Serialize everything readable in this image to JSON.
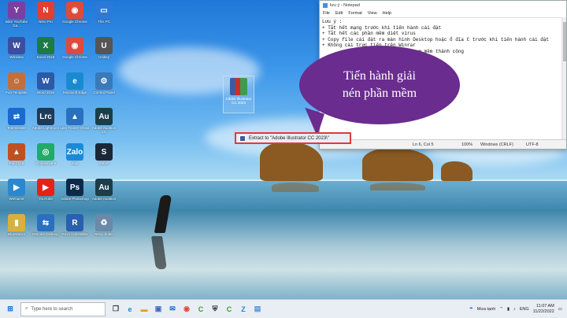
{
  "desktop_icons": [
    {
      "label": "Bâm YouTube Ga...",
      "color": "#7b3fa0",
      "glyph": "Y",
      "icon": "app-icon"
    },
    {
      "label": "Nitro Pro",
      "color": "#e04030",
      "glyph": "N",
      "icon": "nitro-icon"
    },
    {
      "label": "Google Chrome",
      "color": "#dd4b3a",
      "glyph": "◉",
      "icon": "chrome-icon"
    },
    {
      "label": "This PC",
      "color": "#2c7ad6",
      "glyph": "▭",
      "icon": "pc-icon"
    },
    {
      "label": "Wikiview",
      "color": "#3a4fa0",
      "glyph": "W",
      "icon": "app-icon"
    },
    {
      "label": "Excel 2016",
      "color": "#1d7a45",
      "glyph": "X",
      "icon": "excel-icon"
    },
    {
      "label": "Google Chrome",
      "color": "#dd4b3a",
      "glyph": "◉",
      "icon": "chrome-icon"
    },
    {
      "label": "Unikey",
      "color": "#555",
      "glyph": "U",
      "icon": "app-icon"
    },
    {
      "label": "Fun-Template",
      "color": "#c07040",
      "glyph": "☺",
      "icon": "app-icon"
    },
    {
      "label": "Word 2016",
      "color": "#2a5aa8",
      "glyph": "W",
      "icon": "word-icon"
    },
    {
      "label": "Microsoft Edge",
      "color": "#1a8ad0",
      "glyph": "e",
      "icon": "edge-icon"
    },
    {
      "label": "Control Panel",
      "color": "#3a7ab8",
      "glyph": "⚙",
      "icon": "control-panel-icon"
    },
    {
      "label": "Teamviewer",
      "color": "#1a6ad0",
      "glyph": "⇄",
      "icon": "teamviewer-icon"
    },
    {
      "label": "Adobe Lightroom",
      "color": "#1d3a5a",
      "glyph": "Lrc",
      "icon": "lightroom-icon"
    },
    {
      "label": "Line Trainer Ghost",
      "color": "#2a70c0",
      "glyph": "▲",
      "icon": "app-icon"
    },
    {
      "label": "Adobe Audition CC",
      "color": "#1b3e4a",
      "glyph": "Au",
      "icon": "audition-icon"
    },
    {
      "label": "Far Cry 5",
      "color": "#c05020",
      "glyph": "▲",
      "icon": "game-icon"
    },
    {
      "label": "CloneDrive 5",
      "color": "#22aa66",
      "glyph": "◎",
      "icon": "app-icon"
    },
    {
      "label": "Zalo",
      "color": "#1a8ad8",
      "glyph": "Zalo",
      "icon": "zalo-icon"
    },
    {
      "label": "Steam",
      "color": "#1b2838",
      "glyph": "S",
      "icon": "steam-icon"
    },
    {
      "label": "WeGame",
      "color": "#2a88d0",
      "glyph": "▶",
      "icon": "app-icon"
    },
    {
      "label": "YouTube",
      "color": "#e62117",
      "glyph": "▶",
      "icon": "youtube-icon"
    },
    {
      "label": "Adobe Photoshop",
      "color": "#0b2a4a",
      "glyph": "Ps",
      "icon": "photoshop-icon"
    },
    {
      "label": "Adobe Audition",
      "color": "#1b3e4a",
      "glyph": "Au",
      "icon": "audition-icon"
    },
    {
      "label": "Bluestacks",
      "color": "#d8b040",
      "glyph": "▮",
      "icon": "app-icon"
    },
    {
      "label": "Remote Desktop",
      "color": "#2a70c0",
      "glyph": "⇆",
      "icon": "app-icon"
    },
    {
      "label": "Revo Uninstaller",
      "color": "#2a60b0",
      "glyph": "R",
      "icon": "app-icon"
    },
    {
      "label": "Recycle Bin",
      "color": "#6a8aa8",
      "glyph": "♻",
      "icon": "recycle-bin-icon"
    }
  ],
  "rar_file": {
    "label": "Adobe Illustrator CC 2023"
  },
  "context": {
    "label": "Extract to \"Adobe Illustrator CC 2023\\\""
  },
  "callout": {
    "line1": "Tiến hành giải",
    "line2": "nén phần mềm"
  },
  "notepad": {
    "title": "lưu ý - Notepad",
    "menu": [
      "File",
      "Edit",
      "Format",
      "View",
      "Help"
    ],
    "lines": [
      "Lưu ý :",
      "+ Tắt hết mạng trước khi tiến hành cài đặt",
      "+ Tắt hết các phần mềm diệt virus",
      "+ Copy file cài đặt ra màn hình Desktop hoặc ổ đĩa C trước khi tiến hành cài đặt",
      "+ Không cài trực tiếp trên Winrar",
      "",
      "                                  m mềm thành công"
    ],
    "status": {
      "pos": "Ln 6, Col 5",
      "zoom": "100%",
      "eol": "Windows (CRLF)",
      "enc": "UTF-8"
    }
  },
  "taskbar": {
    "search_placeholder": "Type here to search",
    "weather": "Mưa tạnh",
    "lang": "ENG",
    "time": "11:07 AM",
    "date": "11/22/2022"
  },
  "colors": {
    "callout": "#6a2c8f",
    "highlight": "#e53935"
  }
}
